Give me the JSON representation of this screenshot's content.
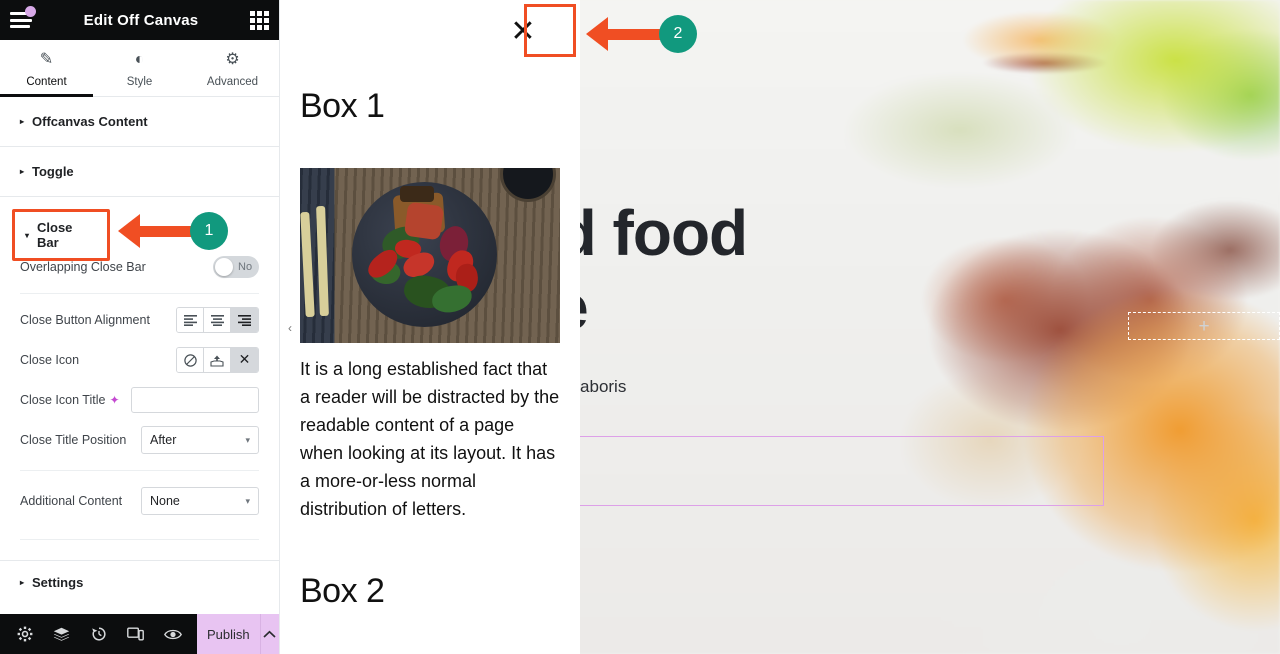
{
  "panel": {
    "header": {
      "title": "Edit Off Canvas",
      "menu_icon": "hamburger-menu-icon",
      "apps_icon": "grid-apps-icon"
    },
    "tabs": [
      {
        "label": "Content",
        "icon": "pencil-icon",
        "glyph": "✎",
        "active": true
      },
      {
        "label": "Style",
        "icon": "half-circle-contrast-icon",
        "glyph": "◐",
        "active": false
      },
      {
        "label": "Advanced",
        "icon": "gear-icon",
        "glyph": "⚙",
        "active": false
      }
    ],
    "sections": [
      {
        "label": "Offcanvas Content",
        "expanded": false,
        "caret": "▸"
      },
      {
        "label": "Toggle",
        "expanded": false,
        "caret": "▸"
      },
      {
        "label": "Close Bar",
        "expanded": true,
        "caret": "▾"
      },
      {
        "label": "Settings",
        "expanded": false,
        "caret": "▸"
      }
    ],
    "close_bar": {
      "overlapping": {
        "label": "Overlapping Close Bar",
        "value": "No",
        "state": "off"
      },
      "alignment": {
        "label": "Close Button Alignment",
        "options": [
          "align-left-icon",
          "align-center-icon",
          "align-right-icon"
        ],
        "glyphs": [
          "☰",
          "☰",
          "☰"
        ],
        "selected_index": 2
      },
      "close_icon": {
        "label": "Close Icon",
        "options": [
          "none-icon",
          "upload-icon",
          "x-close-icon"
        ],
        "glyphs": [
          "⊘",
          "⤒",
          "✕"
        ],
        "selected_index": 2
      },
      "icon_title": {
        "label": "Close Icon Title",
        "value": "",
        "placeholder": "",
        "ai_icon": "ai-sparkle-icon",
        "ai_glyph": "✦"
      },
      "title_position": {
        "label": "Close Title Position",
        "value": "After",
        "chevron": "▾"
      },
      "additional_content": {
        "label": "Additional Content",
        "value": "None",
        "chevron": "▾"
      }
    },
    "footer": {
      "icons": [
        {
          "name": "settings-gear-icon",
          "glyph": "⚙"
        },
        {
          "name": "navigator-layers-icon",
          "glyph": "≣"
        },
        {
          "name": "history-revisions-icon",
          "glyph": "↺"
        },
        {
          "name": "responsive-preview-icon",
          "glyph": "▭"
        },
        {
          "name": "preview-eye-icon",
          "glyph": "◉"
        }
      ],
      "publish_label": "Publish",
      "publish_chevron": "ⱏ"
    }
  },
  "offcanvas": {
    "close_button_glyph": "✕",
    "heading_1": "Box 1",
    "paragraph": "It is a long established fact that a reader will be distracted by the readable content of a page when looking at its layout.  It has a more-or-less normal distribution of letters.",
    "heading_2": "Box 2",
    "collapse_chevron": "‹",
    "image_alt": "plate-of-salad-photo"
  },
  "canvas": {
    "hero_heading": "e good food\nt smile",
    "hero_paragraph": "rud exercitation ullamco laboris\nequat is aute irure.",
    "add_element_glyph": "+"
  },
  "annotations": [
    {
      "number": "1",
      "target": "close-bar-section"
    },
    {
      "number": "2",
      "target": "offcanvas-close-button"
    }
  ],
  "colors": {
    "annotation_circle": "#11997e",
    "annotation_arrow": "#f04e23",
    "publish_button": "#e8c4f2",
    "panel_header": "#0c0d0e",
    "selection_outline": "#dda0e8"
  }
}
